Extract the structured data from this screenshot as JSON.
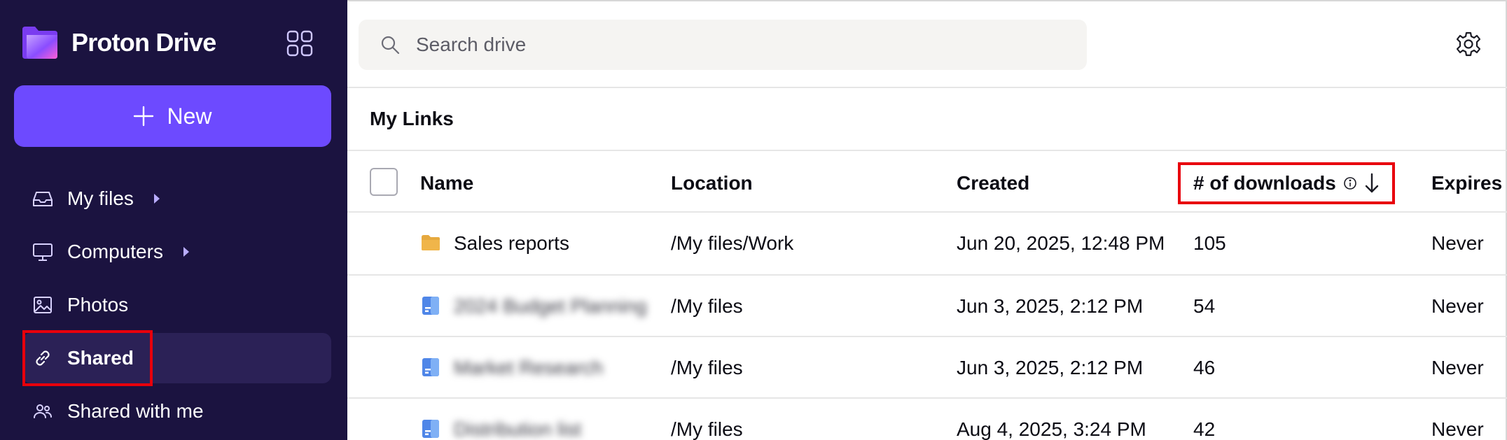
{
  "app": {
    "name": "Proton Drive"
  },
  "sidebar": {
    "new_label": "New",
    "items": [
      {
        "label": "My files"
      },
      {
        "label": "Computers"
      },
      {
        "label": "Photos"
      },
      {
        "label": "Shared"
      },
      {
        "label": "Shared with me"
      }
    ]
  },
  "search": {
    "placeholder": "Search drive"
  },
  "section": {
    "title": "My Links"
  },
  "table": {
    "headers": {
      "name": "Name",
      "location": "Location",
      "created": "Created",
      "downloads": "# of downloads",
      "expires": "Expires"
    },
    "rows": [
      {
        "name": "Sales reports",
        "type": "folder",
        "location": "/My files/Work",
        "created": "Jun 20, 2025, 12:48 PM",
        "downloads": "105",
        "expires": "Never"
      },
      {
        "name": "2024 Budget Planning",
        "type": "document",
        "location": "/My files",
        "created": "Jun 3, 2025, 2:12 PM",
        "downloads": "54",
        "expires": "Never"
      },
      {
        "name": "Market Research",
        "type": "document",
        "location": "/My files",
        "created": "Jun 3, 2025, 2:12 PM",
        "downloads": "46",
        "expires": "Never"
      },
      {
        "name": "Distribution list",
        "type": "document",
        "location": "/My files",
        "created": "Aug 4, 2025, 3:24 PM",
        "downloads": "42",
        "expires": "Never"
      }
    ]
  },
  "colors": {
    "sidebar_bg": "#1b1340",
    "accent": "#6d4aff",
    "highlight": "#e8000b",
    "folder": "#e6a93e",
    "doc": "#4f86e8"
  }
}
